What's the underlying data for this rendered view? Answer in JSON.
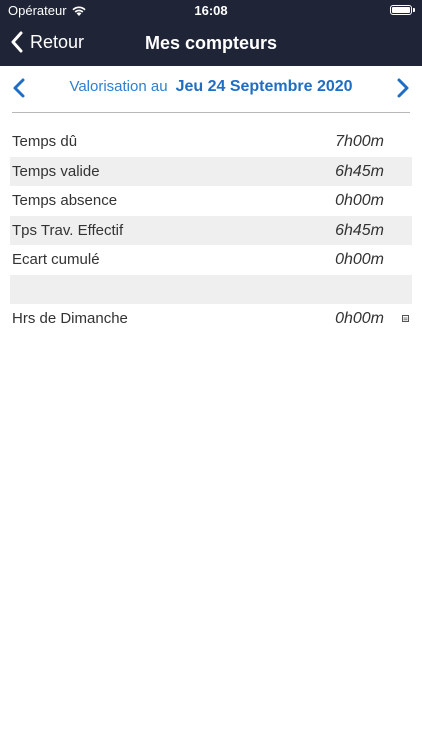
{
  "status_bar": {
    "carrier": "Opérateur",
    "time": "16:08"
  },
  "nav": {
    "back_label": "Retour",
    "title": "Mes compteurs"
  },
  "date_bar": {
    "label": "Valorisation au",
    "date": "Jeu 24 Septembre 2020"
  },
  "rows": [
    {
      "label": "Temps dû",
      "value": "7h00m"
    },
    {
      "label": "Temps valide",
      "value": "6h45m"
    },
    {
      "label": "Temps absence",
      "value": "0h00m"
    },
    {
      "label": "Tps Trav. Effectif",
      "value": "6h45m"
    },
    {
      "label": "Ecart cumulé",
      "value": "0h00m"
    },
    {
      "label": "",
      "value": ""
    },
    {
      "label": "Hrs de Dimanche",
      "value": "0h00m"
    }
  ],
  "colors": {
    "header_bg": "#1f2536",
    "accent": "#1f6ec4",
    "row_shade": "#efefef"
  }
}
